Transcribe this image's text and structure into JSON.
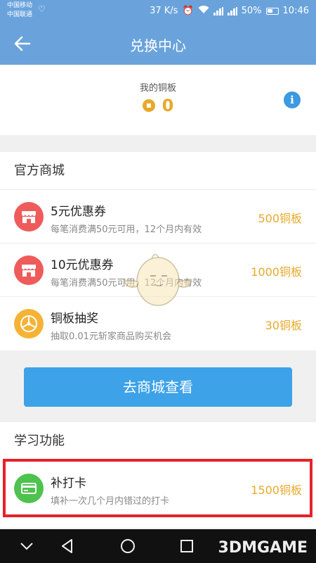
{
  "status_bar": {
    "carrier1": "中国移动",
    "carrier2": "中国联通",
    "speed": "37 K/s",
    "battery": "50%",
    "time": "10:46"
  },
  "app_bar": {
    "title": "兑换中心"
  },
  "balance": {
    "label": "我的铜板",
    "value": "0"
  },
  "official_mall": {
    "title": "官方商城",
    "items": [
      {
        "name": "5元优惠券",
        "desc": "每笔消费满50元可用，12个月内有效",
        "price": "500铜板",
        "icon": "shop-icon",
        "color": "#ef5b5b"
      },
      {
        "name": "10元优惠券",
        "desc": "每笔消费满50元可用，12个月内有效",
        "price": "1000铜板",
        "icon": "shop-icon",
        "color": "#ef5b5b"
      },
      {
        "name": "铜板抽奖",
        "desc": "抽取0.01元斩家商品购买机会",
        "price": "30铜板",
        "icon": "lottery-wheel-icon",
        "color": "#f5b335"
      }
    ]
  },
  "mall_button": {
    "label": "去商城查看"
  },
  "study": {
    "title": "学习功能",
    "items": [
      {
        "name": "补打卡",
        "desc": "填补一次几个月内错过的打卡",
        "price": "1500铜板",
        "icon": "card-icon",
        "color": "#4ec24e"
      }
    ]
  },
  "watermark": "3DMGAME",
  "colors": {
    "primary": "#6aa3dc",
    "accent": "#e9a82a",
    "button": "#3da2e8",
    "highlight": "#e3232b"
  }
}
